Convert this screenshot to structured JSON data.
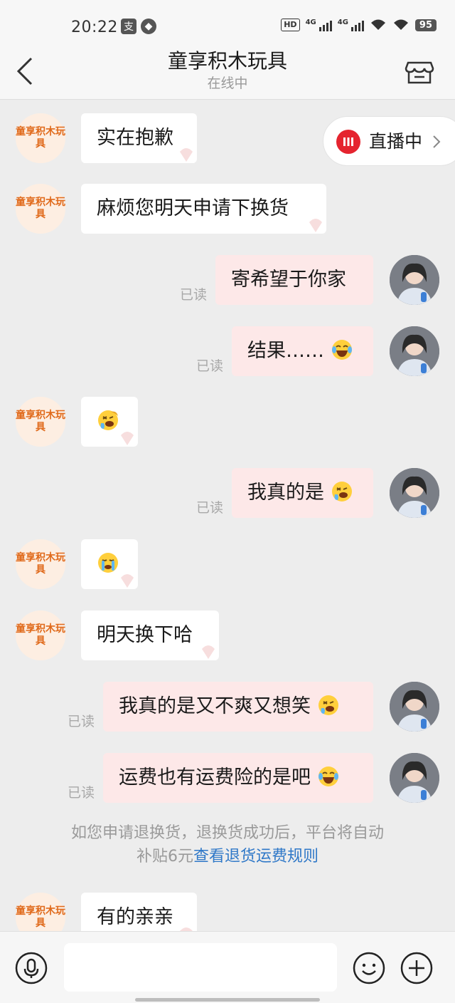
{
  "status_bar": {
    "time": "20:22",
    "network_1": "4G",
    "network_2": "4G",
    "hd": "HD",
    "battery": "95"
  },
  "header": {
    "title": "童享积木玩具",
    "subtitle": "在线中"
  },
  "shop_avatar_text": "童享积木玩具",
  "live_badge": {
    "label": "直播中"
  },
  "read_label": "已读",
  "messages": [
    {
      "side": "left",
      "text": "实在抱歉"
    },
    {
      "side": "left",
      "text": "麻烦您明天申请下换货"
    },
    {
      "side": "right",
      "text": "寄希望于你家",
      "read": "已读"
    },
    {
      "side": "right",
      "text": "结果……",
      "emoji": "laughing-tears",
      "read": "已读"
    },
    {
      "side": "left",
      "text": "",
      "emoji": "crying-laughing"
    },
    {
      "side": "right",
      "text": "我真的是",
      "emoji": "crying-laughing",
      "read": "已读"
    },
    {
      "side": "left",
      "text": "",
      "emoji": "crying"
    },
    {
      "side": "left",
      "text": "明天换下哈"
    },
    {
      "side": "right",
      "text": "我真的是又不爽又想笑",
      "emoji": "crying-laughing",
      "read": "已读"
    },
    {
      "side": "right",
      "text": "运费也有运费险的是吧",
      "emoji": "laughing-tears",
      "read": "已读"
    },
    {
      "side": "left",
      "text": "有的亲亲"
    }
  ],
  "notice": {
    "line1": "如您申请退换货，退换货成功后，平台将自动",
    "line2_prefix": "补贴6元",
    "line2_link": "查看退货运费规则"
  },
  "input_bar": {
    "placeholder": ""
  },
  "colors": {
    "accent_link": "#2f78c8",
    "live_red": "#e5242f",
    "shop_avatar_text": "#e06a1b",
    "right_bubble": "#fde8e8"
  }
}
